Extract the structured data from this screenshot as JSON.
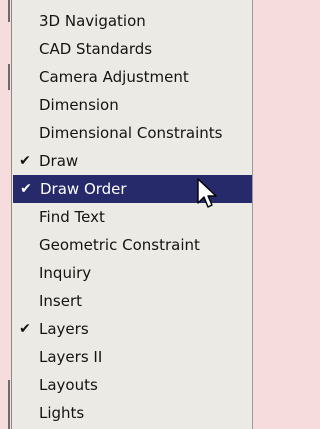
{
  "menu": {
    "items": [
      {
        "label": "3D Navigation",
        "checked": false,
        "highlighted": false
      },
      {
        "label": "CAD Standards",
        "checked": false,
        "highlighted": false
      },
      {
        "label": "Camera Adjustment",
        "checked": false,
        "highlighted": false
      },
      {
        "label": "Dimension",
        "checked": false,
        "highlighted": false
      },
      {
        "label": "Dimensional Constraints",
        "checked": false,
        "highlighted": false
      },
      {
        "label": "Draw",
        "checked": true,
        "highlighted": false
      },
      {
        "label": "Draw Order",
        "checked": true,
        "highlighted": true
      },
      {
        "label": "Find Text",
        "checked": false,
        "highlighted": false
      },
      {
        "label": "Geometric Constraint",
        "checked": false,
        "highlighted": false
      },
      {
        "label": "Inquiry",
        "checked": false,
        "highlighted": false
      },
      {
        "label": "Insert",
        "checked": false,
        "highlighted": false
      },
      {
        "label": "Layers",
        "checked": true,
        "highlighted": false
      },
      {
        "label": "Layers II",
        "checked": false,
        "highlighted": false
      },
      {
        "label": "Layouts",
        "checked": false,
        "highlighted": false
      },
      {
        "label": "Lights",
        "checked": false,
        "highlighted": false
      }
    ],
    "check_glyph": "✔",
    "colors": {
      "menu_background": "#ebeae4",
      "highlight_background": "#262a6b",
      "highlight_text": "#ffffff",
      "page_background": "#f6dcdc"
    }
  },
  "cursor": {
    "icon": "arrow-cursor-icon"
  }
}
